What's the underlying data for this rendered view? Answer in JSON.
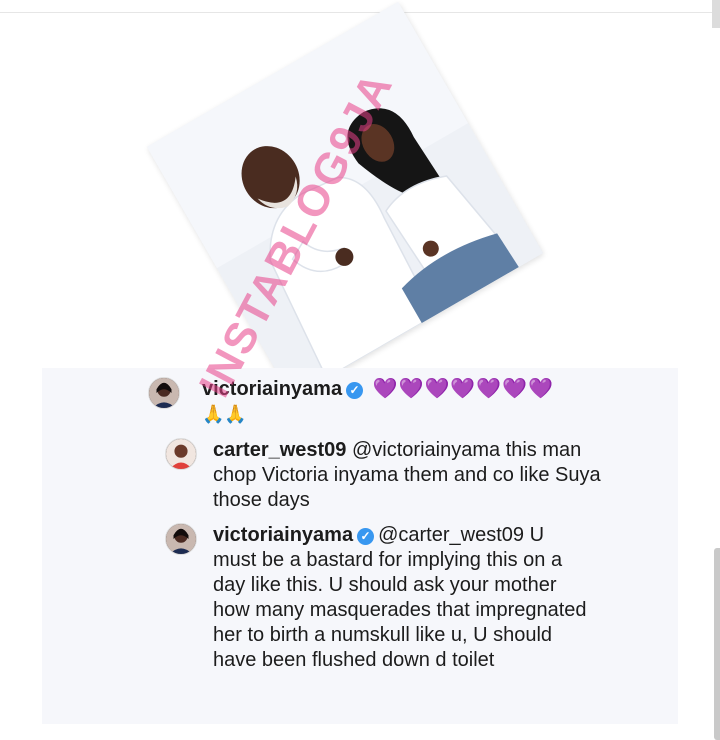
{
  "post": {
    "photo_alt": "photo"
  },
  "comments": {
    "main": {
      "username": "victoriainyama",
      "hearts": "💜💜💜💜💜💜💜",
      "emojis": "🙏🙏"
    },
    "reply1": {
      "username": "carter_west09",
      "mention": "@victoriainyama",
      "text": "this man chop Victoria inyama them and co like Suya those days"
    },
    "reply2": {
      "username": "victoriainyama",
      "mention": "@carter_west09",
      "text": "U must be a bastard for implying this on a day like this. U should ask your mother how many masquerades that impregnated her to birth a numskull like u, U should have been flushed down d toilet"
    }
  },
  "watermark": "INSTABLOG9JA",
  "colors": {
    "verified": "#3897f0",
    "heart": "#9b30ff",
    "watermark": "#e84088",
    "panel_bg": "#f6f7fb"
  }
}
